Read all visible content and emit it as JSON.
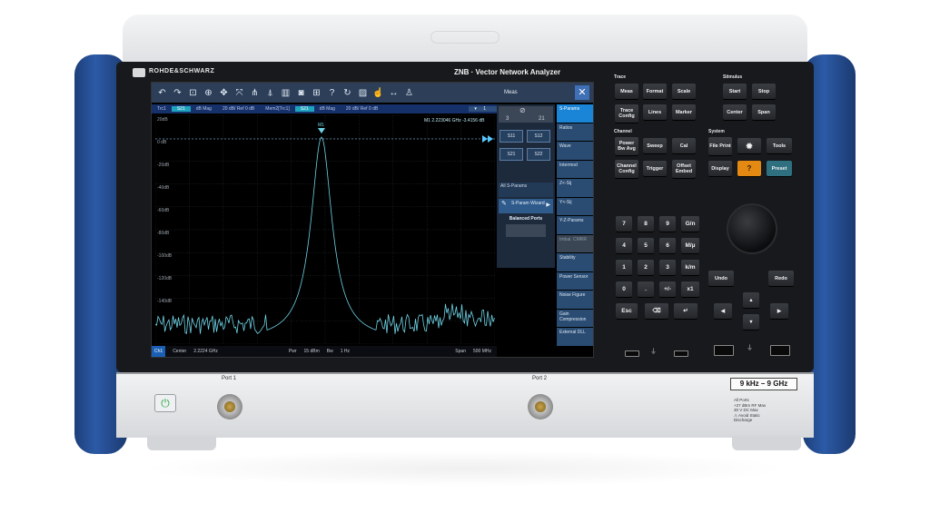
{
  "brand": "ROHDE&SCHWARZ",
  "model": "ZNB · Vector Network Analyzer",
  "screen": {
    "toolbar_icons": [
      "undo-icon",
      "redo-icon",
      "zoom-window-icon",
      "zoom-icon",
      "zoom-pan-icon",
      "resize-icon",
      "marker-icon",
      "marker-search-icon",
      "delete-icon",
      "camera-icon",
      "windows-icon",
      "help-icon",
      "refresh-icon",
      "display-layout-icon",
      "touch-icon",
      "arrows-icon",
      "user-icon"
    ],
    "meas_title": "Meas",
    "infobar": {
      "trace1": "Trc1",
      "param1": "S21",
      "format1": "dB Mag",
      "scale1": "20 dB/ Ref 0 dB",
      "trace2": "Mem2[Trc1]",
      "param2": "S21",
      "format2": "dB Mag",
      "scale2": "20 dB/ Ref 0 dB",
      "count": "1"
    },
    "marker_readout": "M1 2.223046   GHz -3.4156   dB",
    "marker_label": "M1",
    "ref_label": "0 dB",
    "status": {
      "channel": "Ch1",
      "center_label": "Center",
      "center": "2.2224 GHz",
      "pwr_label": "Pwr",
      "pwr": "15 dBm",
      "bw_label": "Bw",
      "bw": "1 Hz",
      "span_label": "Span",
      "span": "500 MHz"
    },
    "softkeys": [
      {
        "label": "S-Params",
        "state": "active"
      },
      {
        "label": "Ratios",
        "state": "normal"
      },
      {
        "label": "Wave",
        "state": "normal"
      },
      {
        "label": "Intermod",
        "state": "normal"
      },
      {
        "label": "Z<-Sij",
        "state": "normal"
      },
      {
        "label": "Y<-Sij",
        "state": "normal"
      },
      {
        "label": "Y-Z-Params",
        "state": "normal"
      },
      {
        "label": "Imbal. CMRR",
        "state": "dim"
      },
      {
        "label": "Stability",
        "state": "normal"
      },
      {
        "label": "Power Sensor",
        "state": "normal"
      },
      {
        "label": "Noise Figure",
        "state": "normal"
      },
      {
        "label": "Gain Compression",
        "state": "normal"
      },
      {
        "label": "External DLL",
        "state": "normal"
      }
    ],
    "dialog": {
      "counter_left": "3",
      "counter_right": "21",
      "sparams": [
        "S11",
        "S12",
        "S21",
        "S22"
      ],
      "all_sparams": "All S-Params",
      "wizard": "S-Param Wizard",
      "balanced": "Balanced Ports"
    },
    "y_ticks": [
      "20dB",
      "0 dB",
      "-20dB",
      "-40dB",
      "-60dB",
      "-80dB",
      "-100dB",
      "-120dB",
      "-140dB"
    ]
  },
  "keys": {
    "sections": {
      "trace": "Trace",
      "stimulus": "Stimulus",
      "channel": "Channel",
      "system": "System"
    },
    "trace": [
      "Meas",
      "Format",
      "Scale",
      "Trace Config",
      "Lines",
      "Marker"
    ],
    "stimulus": [
      "Start",
      "Stop",
      "Center",
      "Span"
    ],
    "channel": [
      "Power Bw Avg",
      "Sweep",
      "Cal",
      "Channel Config",
      "Trigger",
      "Offset Embed"
    ],
    "system": [
      "File Print",
      "Tools",
      "Display",
      "Preset"
    ],
    "numpad": [
      "7",
      "8",
      "9",
      "G/n",
      "4",
      "5",
      "6",
      "M/µ",
      "1",
      "2",
      "3",
      "k/m",
      "0",
      ".",
      "+/-",
      "x1",
      "Esc",
      "⌫",
      "↵"
    ],
    "undo": "Undo",
    "redo": "Redo"
  },
  "lower": {
    "port1": "Port 1",
    "port2": "Port 2",
    "freq_range": "9 kHz – 9 GHz",
    "warning": [
      "All Ports",
      "+27 dBm RF Max",
      "30 V DC Max",
      "⚠ Avoid Static",
      "Discharge"
    ]
  }
}
